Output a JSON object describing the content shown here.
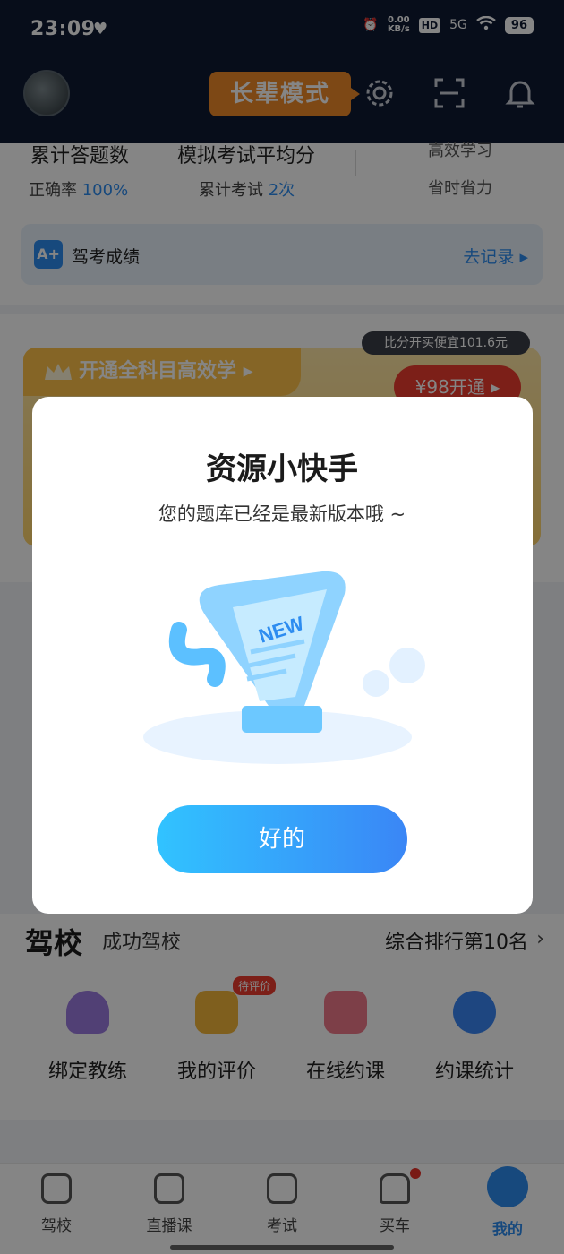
{
  "status_bar": {
    "time": "23:09",
    "net_speed_value": "0.00",
    "net_speed_unit": "KB/s",
    "hd": "HD",
    "signal": "5G",
    "battery": "96"
  },
  "header": {
    "elder_mode_label": "长辈模式"
  },
  "stats": {
    "total_answers_label": "累计答题数",
    "accuracy_label": "正确率",
    "accuracy_value": "100%",
    "mock_avg_label": "模拟考试平均分",
    "mock_count_label": "累计考试",
    "mock_count_value": "2次",
    "efficient_label": "高效学习",
    "save_time_label": "省时省力"
  },
  "score_card": {
    "icon_text": "A+",
    "label": "驾考成绩",
    "link": "去记录 ▸"
  },
  "vip": {
    "tag": "开通全科目高效学 ▸",
    "bubble": "比分开买便宜101.6元",
    "button": "¥98开通 ▸"
  },
  "dialog": {
    "title": "资源小快手",
    "message": "您的题库已经是最新版本哦 ~",
    "illustration_text": "NEW",
    "ok_button": "好的"
  },
  "school": {
    "title": "驾校",
    "name": "成功驾校",
    "rank": "综合排行第10名",
    "pending_badge": "待评价",
    "features": [
      {
        "label": "绑定教练",
        "icon": "coach-icon"
      },
      {
        "label": "我的评价",
        "icon": "review-icon"
      },
      {
        "label": "在线约课",
        "icon": "booking-icon"
      },
      {
        "label": "约课统计",
        "icon": "stats-icon"
      }
    ]
  },
  "nav": {
    "items": [
      {
        "label": "驾校",
        "icon": "school-icon"
      },
      {
        "label": "直播课",
        "icon": "live-icon"
      },
      {
        "label": "考试",
        "icon": "exam-icon"
      },
      {
        "label": "买车",
        "icon": "car-icon"
      },
      {
        "label": "我的",
        "icon": "profile-icon",
        "active": true
      }
    ]
  },
  "colors": {
    "accent": "#2d8cf0",
    "header_bg": "#0f1a33",
    "elder_mode": "#f08a2a",
    "vip_red": "#ee3c2f"
  }
}
